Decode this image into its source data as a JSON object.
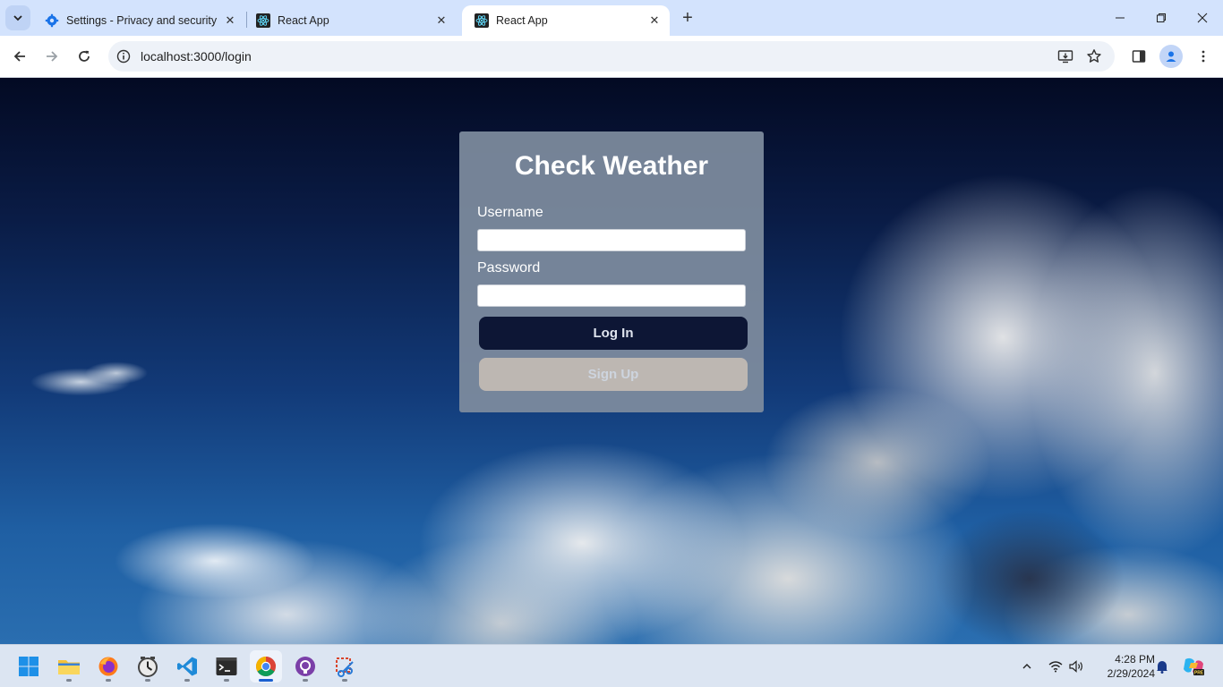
{
  "browser": {
    "tabs": [
      {
        "title": "Settings - Privacy and security",
        "favicon": "settings-gear-icon",
        "active": false
      },
      {
        "title": "React App",
        "favicon": "react-icon",
        "active": false
      },
      {
        "title": "React App",
        "favicon": "react-icon",
        "active": true
      }
    ],
    "url": "localhost:3000/login"
  },
  "login": {
    "title": "Check Weather",
    "username_label": "Username",
    "username_value": "",
    "password_label": "Password",
    "password_value": "",
    "login_button": "Log In",
    "signup_button": "Sign Up"
  },
  "taskbar": {
    "apps": [
      "start-icon",
      "file-explorer-icon",
      "firefox-icon",
      "clock-app-icon",
      "vscode-icon",
      "terminal-icon",
      "chrome-icon",
      "github-desktop-icon",
      "snipping-tool-icon"
    ],
    "time": "4:28 PM",
    "date": "2/29/2024"
  },
  "colors": {
    "tab_strip": "#d3e3fd",
    "card_bg": "#7e8c9e",
    "login_btn": "#0d1635",
    "signup_btn": "#bdb7b2"
  }
}
